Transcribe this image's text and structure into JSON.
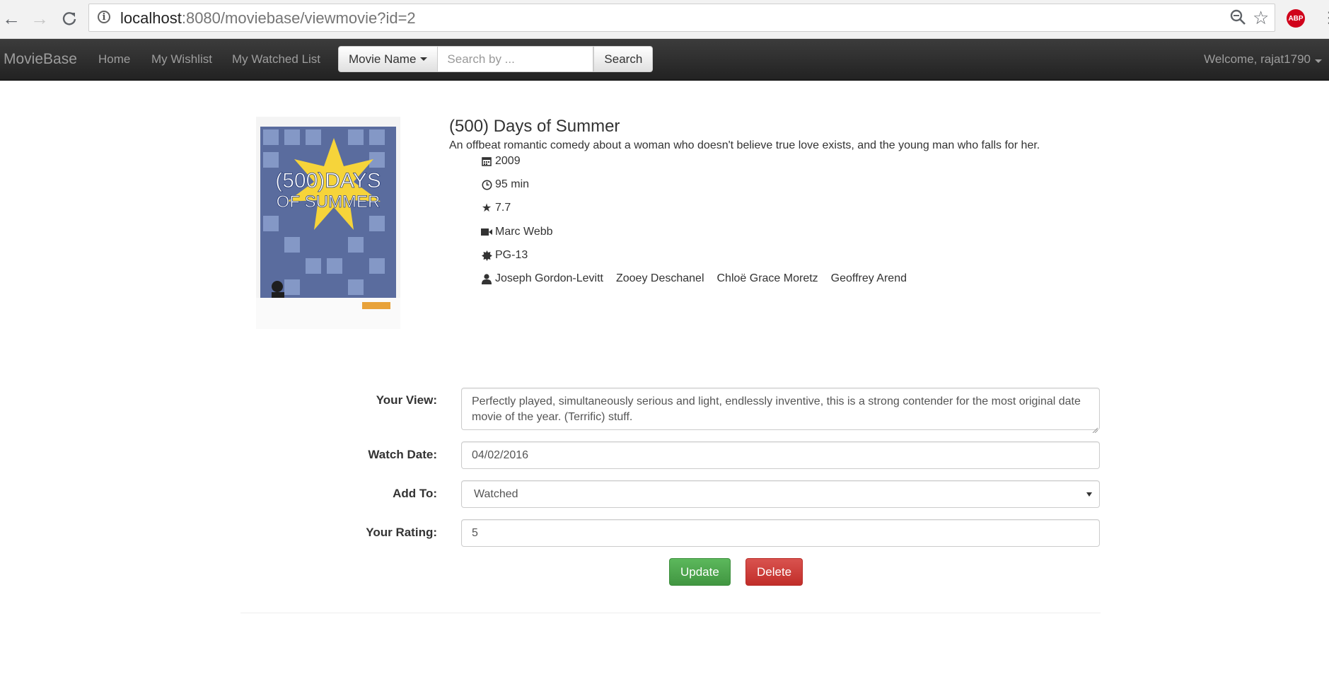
{
  "browser": {
    "url_host": "localhost",
    "url_path": ":8080/moviebase/viewmovie?id=2",
    "extension_label": "ABP"
  },
  "navbar": {
    "brand": "MovieBase",
    "links": [
      "Home",
      "My Wishlist",
      "My Watched List"
    ],
    "search_type": "Movie Name",
    "search_placeholder": "Search by ...",
    "search_button": "Search",
    "welcome": "Welcome, rajat1790"
  },
  "movie": {
    "title": "(500) Days of Summer",
    "description": "An offbeat romantic comedy about a woman who doesn't believe true love exists, and the young man who falls for her.",
    "year": "2009",
    "runtime": "95 min",
    "rating": "7.7",
    "director": "Marc Webb",
    "certificate": "PG-13",
    "cast": [
      "Joseph Gordon-Levitt",
      "Zooey Deschanel",
      "Chloë Grace Moretz",
      "Geoffrey Arend"
    ],
    "poster": {
      "title_line1": "(500)DAYS",
      "title_line2": "OF SUMMER",
      "accent_color": "#f6d43a"
    }
  },
  "form": {
    "view_label": "Your View:",
    "view_value": "Perfectly played, simultaneously serious and light, endlessly inventive, this is a strong contender for the most original date movie of the year. (Terrific) stuff.",
    "date_label": "Watch Date:",
    "date_value": "04/02/2016",
    "addto_label": "Add To:",
    "addto_value": "Watched",
    "rating_label": "Your Rating:",
    "rating_value": "5",
    "update_button": "Update",
    "delete_button": "Delete"
  },
  "colors": {
    "navbar_bg": "#222222",
    "update_green": "#4cae4c",
    "delete_red": "#d43f3a"
  }
}
